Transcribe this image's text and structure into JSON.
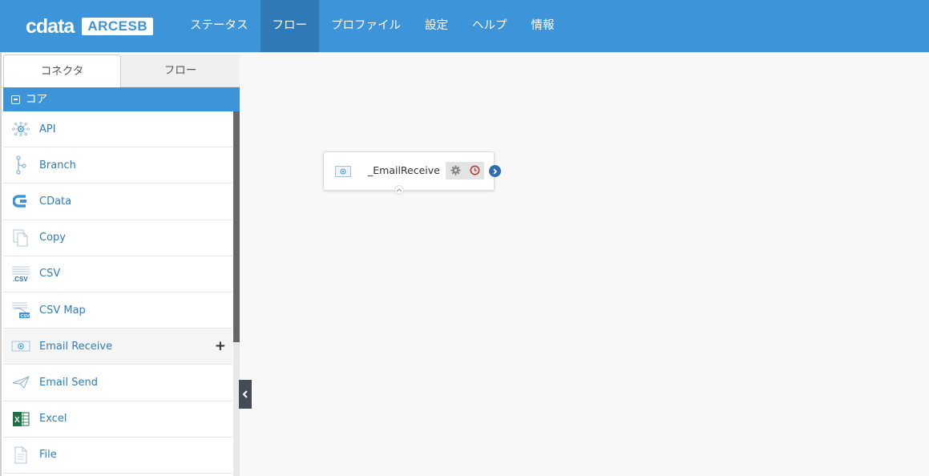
{
  "header": {
    "logo_text": "cdata",
    "product_badge": "ARCESB",
    "nav": [
      {
        "label": "ステータス",
        "active": false
      },
      {
        "label": "フロー",
        "active": true
      },
      {
        "label": "プロファイル",
        "active": false
      },
      {
        "label": "設定",
        "active": false
      },
      {
        "label": "ヘルプ",
        "active": false
      },
      {
        "label": "情報",
        "active": false
      }
    ]
  },
  "sidebar": {
    "tabs": [
      {
        "label": "コネクタ",
        "active": true
      },
      {
        "label": "フロー",
        "active": false
      }
    ],
    "section": "コア",
    "items": [
      {
        "label": "API",
        "icon": "api-icon"
      },
      {
        "label": "Branch",
        "icon": "branch-icon"
      },
      {
        "label": "CData",
        "icon": "cdata-icon"
      },
      {
        "label": "Copy",
        "icon": "copy-icon"
      },
      {
        "label": "CSV",
        "icon": "csv-icon"
      },
      {
        "label": "CSV Map",
        "icon": "csv-map-icon"
      },
      {
        "label": "Email Receive",
        "icon": "email-receive-icon",
        "hovered": true
      },
      {
        "label": "Email Send",
        "icon": "email-send-icon"
      },
      {
        "label": "Excel",
        "icon": "excel-icon"
      },
      {
        "label": "File",
        "icon": "file-icon"
      }
    ]
  },
  "canvas": {
    "node": {
      "label": "_EmailReceive",
      "icon": "email-receive-icon"
    }
  },
  "colors": {
    "header_bg": "#3d94d9",
    "active_nav": "#2f7ab6",
    "link": "#2d7cc1",
    "node_output": "#2d6fb3"
  }
}
